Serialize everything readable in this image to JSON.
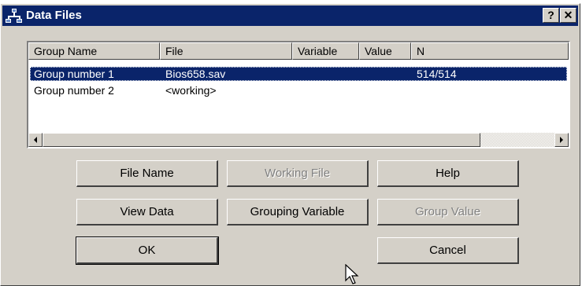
{
  "window": {
    "title": "Data Files",
    "help_glyph": "?",
    "close_glyph": "✕",
    "icon": "data-files-icon"
  },
  "table": {
    "columns": [
      "Group Name",
      "File",
      "Variable",
      "Value",
      "N"
    ],
    "rows": [
      {
        "group": "Group number 1",
        "file": "Bios658.sav",
        "variable": "",
        "value": "",
        "n": "514/514",
        "selected": true
      },
      {
        "group": "Group number 2",
        "file": "<working>",
        "variable": "",
        "value": "",
        "n": "",
        "selected": false
      }
    ]
  },
  "buttons": {
    "file_name": {
      "label": "File Name",
      "enabled": true
    },
    "working_file": {
      "label": "Working File",
      "enabled": false
    },
    "help": {
      "label": "Help",
      "enabled": true
    },
    "view_data": {
      "label": "View Data",
      "enabled": true
    },
    "grouping_variable": {
      "label": "Grouping Variable",
      "enabled": true
    },
    "group_value": {
      "label": "Group Value",
      "enabled": false
    },
    "ok": {
      "label": "OK",
      "enabled": true
    },
    "cancel": {
      "label": "Cancel",
      "enabled": true
    }
  },
  "colors": {
    "title_bar": "#0a246a",
    "selection": "#0a246a",
    "dialog_face": "#d4d0c8"
  }
}
